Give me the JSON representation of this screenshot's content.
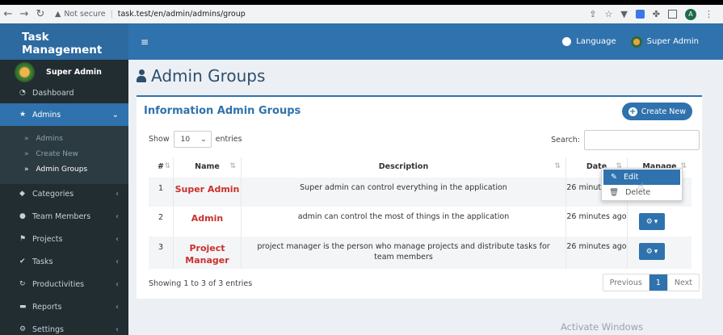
{
  "browser": {
    "back": "←",
    "forward": "→",
    "reload": "↻",
    "security_label": "Not secure",
    "url": "task.test/en/admin/admins/group",
    "profile_initial": "A"
  },
  "header": {
    "brand": "Task Management",
    "menu_icon": "≡",
    "language_label": "Language",
    "user_label": "Super Admin"
  },
  "sidebar": {
    "user_name": "Super Admin",
    "items": [
      {
        "label": "Dashboard",
        "icon": "dashboard-icon",
        "glyph": "◔"
      },
      {
        "label": "Admins",
        "icon": "star-icon",
        "glyph": "★"
      },
      {
        "label": "Categories",
        "icon": "tags-icon",
        "glyph": "◆"
      },
      {
        "label": "Team Members",
        "icon": "users-icon",
        "glyph": "●"
      },
      {
        "label": "Projects",
        "icon": "flag-icon",
        "glyph": "⚑"
      },
      {
        "label": "Tasks",
        "icon": "check-circle-icon",
        "glyph": "✔"
      },
      {
        "label": "Productivities",
        "icon": "refresh-icon",
        "glyph": "↻"
      },
      {
        "label": "Reports",
        "icon": "folder-icon",
        "glyph": "▬"
      },
      {
        "label": "Settings",
        "icon": "cogs-icon",
        "glyph": "⚙"
      }
    ],
    "admins_sub": [
      {
        "label": "Admins"
      },
      {
        "label": "Create New"
      },
      {
        "label": "Admin Groups"
      }
    ]
  },
  "page": {
    "title": "Admin Groups",
    "box_title": "Information Admin Groups",
    "create_label": "Create New",
    "show_label": "Show",
    "entries_value": "10",
    "entries_label": "entries",
    "search_label": "Search:",
    "search_value": "",
    "showing_text": "Showing 1 to 3 of 3 entries",
    "pager": {
      "previous": "Previous",
      "current": "1",
      "next": "Next"
    }
  },
  "table": {
    "headers": [
      "#",
      "Name",
      "Description",
      "Date",
      "Manage"
    ],
    "rows": [
      {
        "num": "1",
        "name": "Super Admin",
        "description": "Super admin can control everything in the application",
        "date": "26 minutes ago"
      },
      {
        "num": "2",
        "name": "Admin",
        "description": "admin can control the most of things in the application",
        "date": "26 minutes ago"
      },
      {
        "num": "3",
        "name": "Project Manager",
        "description": "project manager is the person who manage projects and distribute tasks for team members",
        "date": "26 minutes ago"
      }
    ]
  },
  "dropdown": {
    "edit_label": "Edit",
    "delete_label": "Delete"
  },
  "watermark": "Activate Windows",
  "colors": {
    "primary": "#2f72ad",
    "sidebar_bg": "#222d32",
    "name_red": "#c9302c",
    "content_bg": "#ecf0f5"
  }
}
